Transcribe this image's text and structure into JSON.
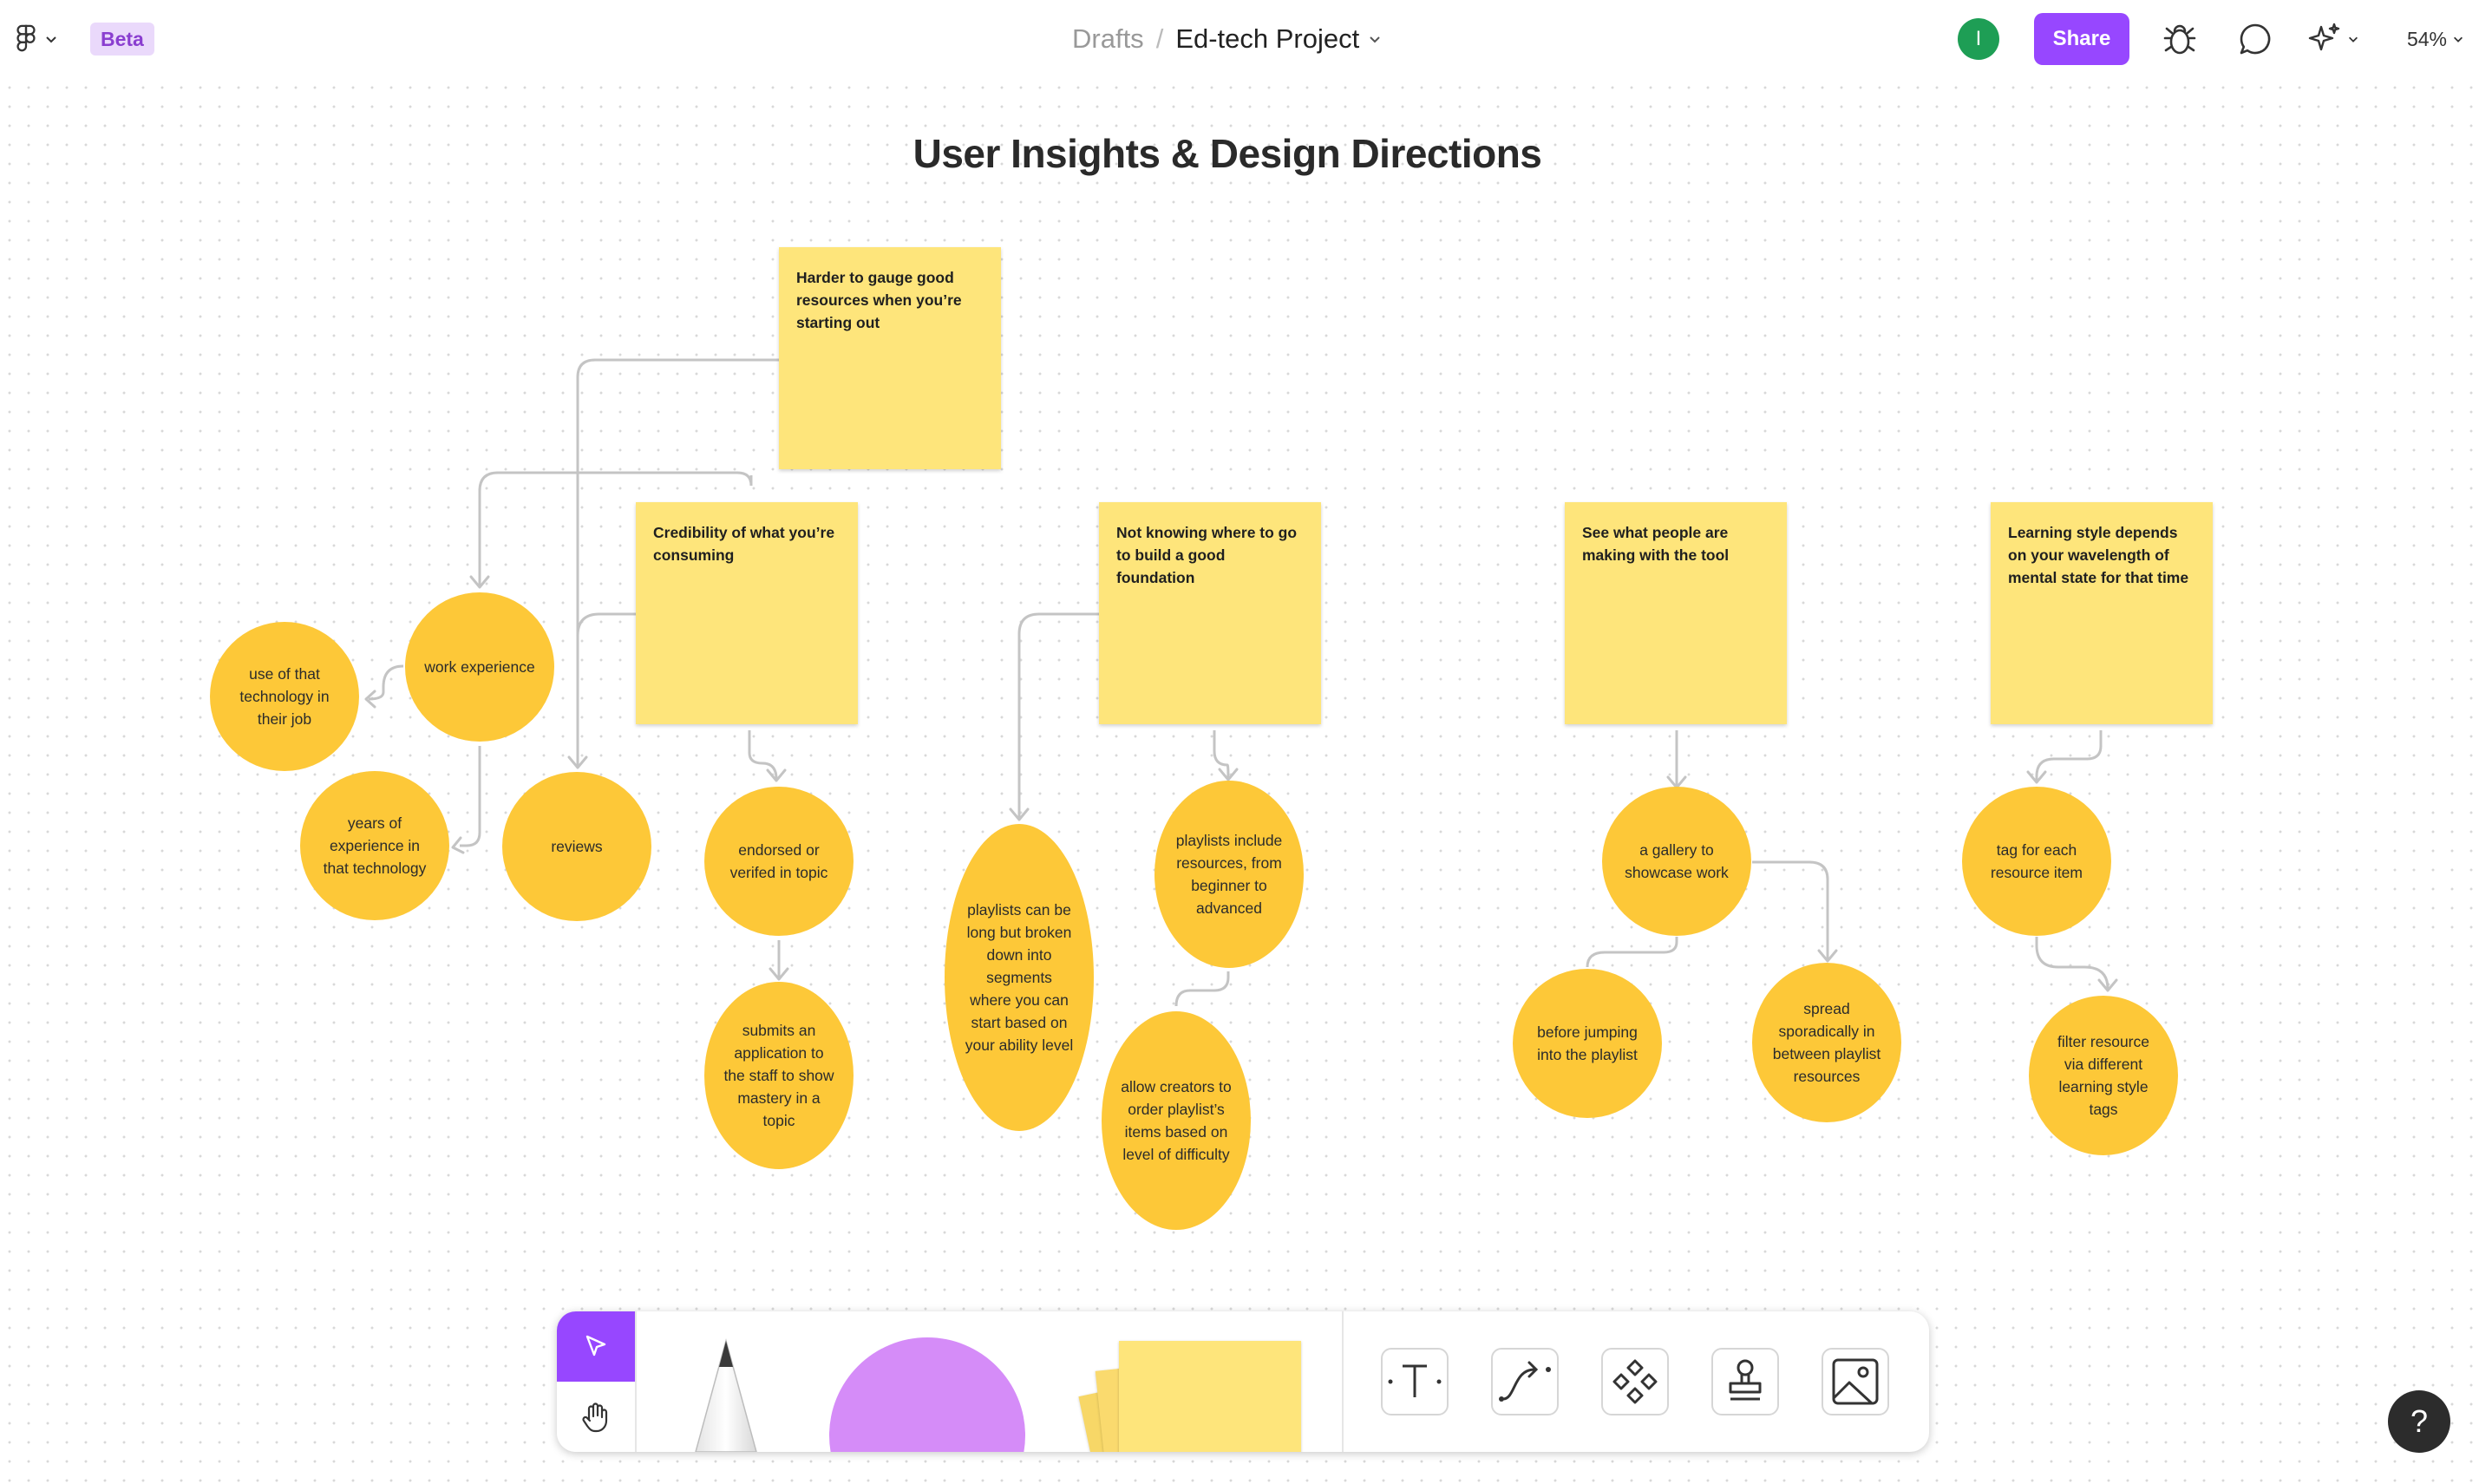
{
  "header": {
    "beta_label": "Beta",
    "breadcrumb_parent": "Drafts",
    "breadcrumb_separator": "/",
    "file_title": "Ed-tech Project",
    "avatar_initial": "I",
    "share_label": "Share",
    "zoom_level": "54%"
  },
  "board": {
    "title": "User Insights &  Design Directions",
    "stickies": {
      "s0": "Harder to gauge good resources when you’re starting out",
      "s1": "Credibility of what you’re consuming",
      "s2": "Not knowing where to go to build a good foundation",
      "s3": "See what people are making with the tool",
      "s4": "Learning style depends on your wavelength of mental state for that time"
    },
    "circles": {
      "work_experience": "work experience",
      "use_of_tech": "use of that technology in their job",
      "years_experience": "years of experience in that technology",
      "reviews": "reviews",
      "endorsed": "endorsed or verifed in topic",
      "submits_application": "submits an application to the staff to show mastery in a topic",
      "playlists_segments": "playlists can be long but broken down into segments where you can start based on your ability level",
      "playlists_include": "playlists include resources, from beginner to advanced",
      "allow_creators": "allow creators to order playlist’s items based on level of difficulty",
      "gallery": "a gallery to showcase work",
      "before_jumping": "before jumping into the playlist",
      "spread": "spread sporadically in between playlist resources",
      "tag_resource": "tag for each resource item",
      "filter_resource": "filter resource via different learning style tags"
    }
  },
  "toolbar": {
    "tools": [
      "move-tool",
      "hand-tool",
      "pen-tool",
      "shape-tool",
      "sticky-tool",
      "text-tool",
      "connector-tool",
      "component-tool",
      "stamp-tool",
      "image-tool"
    ]
  },
  "help": {
    "label": "?"
  },
  "colors": {
    "accent": "#9747ff",
    "sticky": "#fee57b",
    "circle": "#fdc838",
    "avatar": "#1e9e55",
    "connector": "#c4c4c4"
  }
}
